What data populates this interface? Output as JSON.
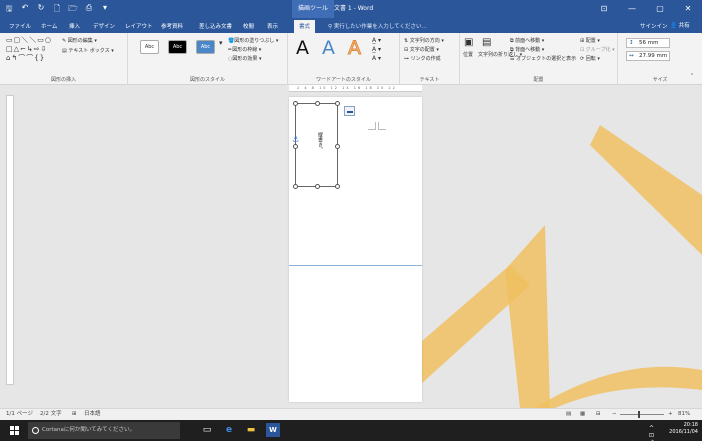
{
  "window": {
    "context_tool": "描画ツール",
    "title": "文書 1 - Word",
    "controls": [
      "⊡",
      "—",
      "▢",
      "✕"
    ]
  },
  "tabs": [
    {
      "label": "ファイル"
    },
    {
      "label": "ホーム"
    },
    {
      "label": "挿入"
    },
    {
      "label": "デザイン"
    },
    {
      "label": "レイアウト"
    },
    {
      "label": "参考資料"
    },
    {
      "label": "差し込み文書"
    },
    {
      "label": "校閲"
    },
    {
      "label": "表示"
    },
    {
      "label": "書式"
    }
  ],
  "tellme": "実行したい作業を入力してください...",
  "account": {
    "signin": "サインイン",
    "share": "共有"
  },
  "ribbon": {
    "insert_shapes": {
      "label": "図形の挿入",
      "edit_shape": "図形の編集 ▾",
      "textbox": "テキスト ボックス ▾"
    },
    "shape_styles": {
      "label": "図形のスタイル",
      "swatches": [
        "Abc",
        "Abc",
        "Abc"
      ],
      "fill": "図形の塗りつぶし ▾",
      "outline": "図形の枠線 ▾",
      "effects": "図形の効果 ▾"
    },
    "wordart": {
      "label": "ワードアートのスタイル"
    },
    "text": {
      "label": "テキスト",
      "direction": "文字列の方向 ▾",
      "align": "文字の配置 ▾",
      "link": "リンクの作成"
    },
    "arrange": {
      "label": "配置",
      "position": "位置",
      "wrap": "文字列の折り返し ▾",
      "forward": "前面へ移動 ▾",
      "backward": "背面へ移動 ▾",
      "selection_pane": "オブジェクトの選択と表示",
      "align": "配置 ▾",
      "group": "グループ化 ▾",
      "rotate": "回転 ▾"
    },
    "size": {
      "label": "サイズ",
      "height": "56 mm",
      "width": "27.99 mm"
    }
  },
  "document": {
    "textbox_text": "縦書き。",
    "ruler_marks": "2 4  8 10 12 14 16 18 20 22"
  },
  "status": {
    "page": "1/1 ページ",
    "words": "2/2 文字",
    "language": "日本語",
    "zoom": "81%"
  },
  "taskbar": {
    "cortana": "Cortanaに何か聞いてみてください。",
    "time": "20:18",
    "date": "2016/11/04"
  }
}
